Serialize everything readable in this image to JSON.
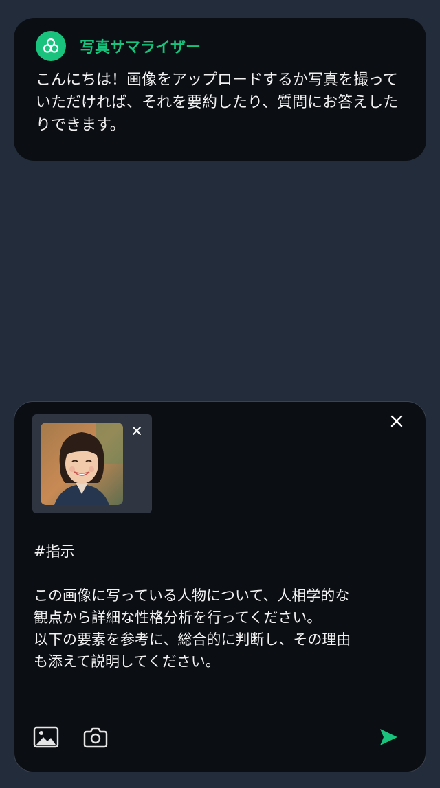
{
  "bot": {
    "name": "写真サマライザー",
    "message": "こんにちは！画像をアップロードするか写真を撮っていただければ、それを要約したり、質問にお答えしたりできます。",
    "avatar_icon": "knot-logo-icon",
    "accent_color": "#19c37d"
  },
  "composer": {
    "attachment": {
      "image": "portrait-photo",
      "remove_icon": "close-icon"
    },
    "close_icon": "close-icon",
    "prompt": "#指示\n\nこの画像に写っている人物について、人相学的な観点から詳細な性格分析を行ってください。\n以下の要素を参考に、総合的に判断し、その理由も添えて説明してください。",
    "toolbar": {
      "gallery_icon": "image-icon",
      "camera_icon": "camera-icon",
      "send_icon": "send-icon"
    }
  }
}
